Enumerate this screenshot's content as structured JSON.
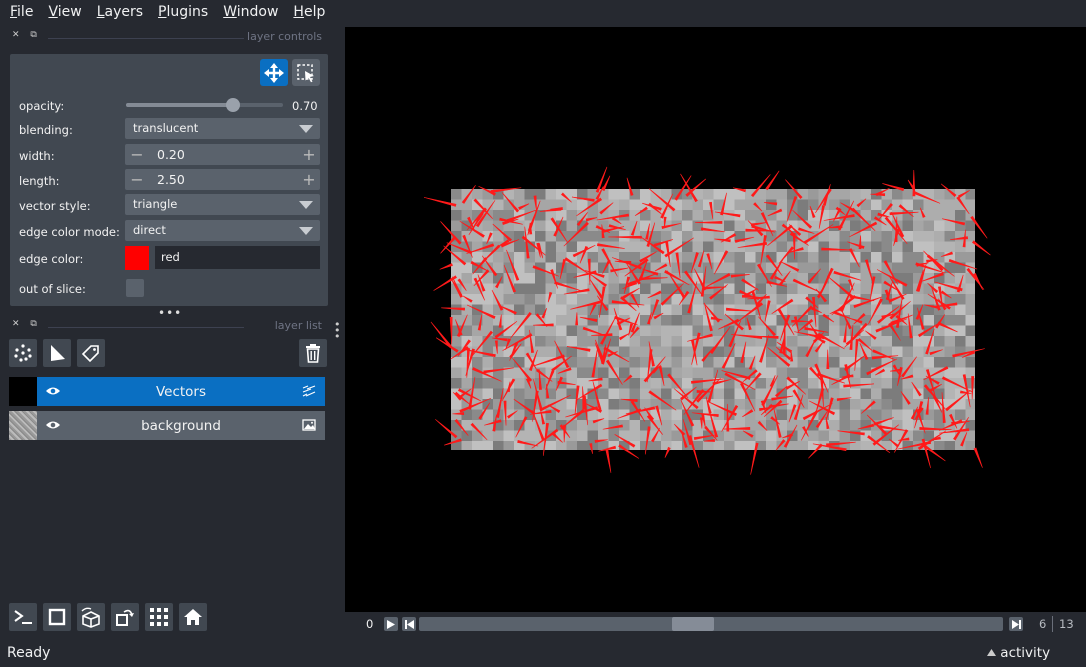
{
  "menu": [
    "File",
    "View",
    "Layers",
    "Plugins",
    "Window",
    "Help"
  ],
  "layer_controls": {
    "title": "layer controls",
    "opacity": {
      "label": "opacity:",
      "value": "0.70",
      "fraction": 0.7
    },
    "blending": {
      "label": "blending:",
      "value": "translucent"
    },
    "width": {
      "label": "width:",
      "value": "0.20"
    },
    "length": {
      "label": "length:",
      "value": "2.50"
    },
    "vector_style": {
      "label": "vector style:",
      "value": "triangle"
    },
    "edge_color_mode": {
      "label": "edge color mode:",
      "value": "direct"
    },
    "edge_color": {
      "label": "edge color:",
      "value": "red",
      "swatch": "#ff0000"
    },
    "out_of_slice": {
      "label": "out of slice:",
      "checked": false
    }
  },
  "layer_list": {
    "title": "layer list",
    "layers": [
      {
        "name": "Vectors",
        "selected": true,
        "visible": true,
        "icon": "vectors-icon"
      },
      {
        "name": "background",
        "selected": false,
        "visible": true,
        "icon": "image-icon"
      }
    ]
  },
  "dims": {
    "axis_label": "0",
    "current": "6",
    "total": "13",
    "position_fraction": 0.46
  },
  "status": {
    "text": "Ready",
    "activity": "activity"
  },
  "colors": {
    "accent": "#0a6fc2",
    "vector": "#ff1a1a",
    "panel": "#414851",
    "bg": "#262930"
  }
}
